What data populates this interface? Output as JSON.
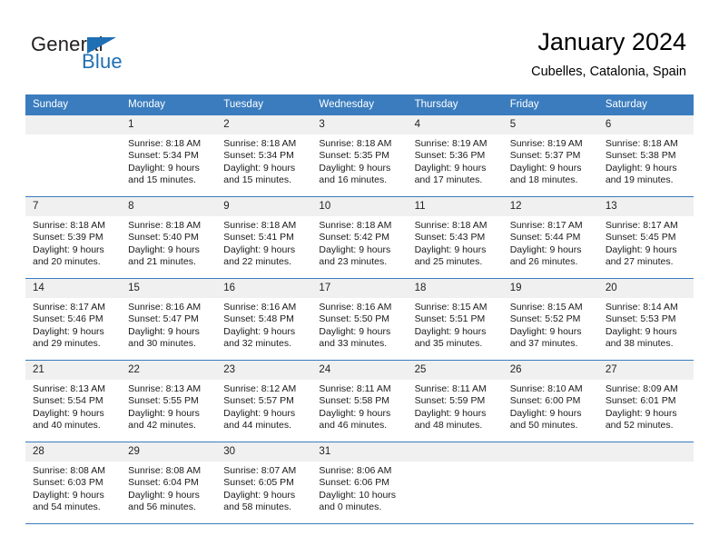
{
  "logo": {
    "word_one": "General",
    "word_two": "Blue",
    "flag_icon": "blue-triangle-flag",
    "accent_color": "#1f6fb4"
  },
  "header": {
    "title": "January 2024",
    "subtitle": "Cubelles, Catalonia, Spain"
  },
  "theme": {
    "header_row_bg": "#3a7cbe",
    "daynum_bg": "#f0f0f0",
    "cell_bg": "#ffffff",
    "text_color": "#000000"
  },
  "weekday_headers": [
    "Sunday",
    "Monday",
    "Tuesday",
    "Wednesday",
    "Thursday",
    "Friday",
    "Saturday"
  ],
  "weeks": [
    [
      {
        "day": "",
        "sunrise": "",
        "sunset": "",
        "daylight_line1": "",
        "daylight_line2": "",
        "empty": true
      },
      {
        "day": "1",
        "sunrise": "Sunrise: 8:18 AM",
        "sunset": "Sunset: 5:34 PM",
        "daylight_line1": "Daylight: 9 hours",
        "daylight_line2": "and 15 minutes.",
        "empty": false
      },
      {
        "day": "2",
        "sunrise": "Sunrise: 8:18 AM",
        "sunset": "Sunset: 5:34 PM",
        "daylight_line1": "Daylight: 9 hours",
        "daylight_line2": "and 15 minutes.",
        "empty": false
      },
      {
        "day": "3",
        "sunrise": "Sunrise: 8:18 AM",
        "sunset": "Sunset: 5:35 PM",
        "daylight_line1": "Daylight: 9 hours",
        "daylight_line2": "and 16 minutes.",
        "empty": false
      },
      {
        "day": "4",
        "sunrise": "Sunrise: 8:19 AM",
        "sunset": "Sunset: 5:36 PM",
        "daylight_line1": "Daylight: 9 hours",
        "daylight_line2": "and 17 minutes.",
        "empty": false
      },
      {
        "day": "5",
        "sunrise": "Sunrise: 8:19 AM",
        "sunset": "Sunset: 5:37 PM",
        "daylight_line1": "Daylight: 9 hours",
        "daylight_line2": "and 18 minutes.",
        "empty": false
      },
      {
        "day": "6",
        "sunrise": "Sunrise: 8:18 AM",
        "sunset": "Sunset: 5:38 PM",
        "daylight_line1": "Daylight: 9 hours",
        "daylight_line2": "and 19 minutes.",
        "empty": false
      }
    ],
    [
      {
        "day": "7",
        "sunrise": "Sunrise: 8:18 AM",
        "sunset": "Sunset: 5:39 PM",
        "daylight_line1": "Daylight: 9 hours",
        "daylight_line2": "and 20 minutes.",
        "empty": false
      },
      {
        "day": "8",
        "sunrise": "Sunrise: 8:18 AM",
        "sunset": "Sunset: 5:40 PM",
        "daylight_line1": "Daylight: 9 hours",
        "daylight_line2": "and 21 minutes.",
        "empty": false
      },
      {
        "day": "9",
        "sunrise": "Sunrise: 8:18 AM",
        "sunset": "Sunset: 5:41 PM",
        "daylight_line1": "Daylight: 9 hours",
        "daylight_line2": "and 22 minutes.",
        "empty": false
      },
      {
        "day": "10",
        "sunrise": "Sunrise: 8:18 AM",
        "sunset": "Sunset: 5:42 PM",
        "daylight_line1": "Daylight: 9 hours",
        "daylight_line2": "and 23 minutes.",
        "empty": false
      },
      {
        "day": "11",
        "sunrise": "Sunrise: 8:18 AM",
        "sunset": "Sunset: 5:43 PM",
        "daylight_line1": "Daylight: 9 hours",
        "daylight_line2": "and 25 minutes.",
        "empty": false
      },
      {
        "day": "12",
        "sunrise": "Sunrise: 8:17 AM",
        "sunset": "Sunset: 5:44 PM",
        "daylight_line1": "Daylight: 9 hours",
        "daylight_line2": "and 26 minutes.",
        "empty": false
      },
      {
        "day": "13",
        "sunrise": "Sunrise: 8:17 AM",
        "sunset": "Sunset: 5:45 PM",
        "daylight_line1": "Daylight: 9 hours",
        "daylight_line2": "and 27 minutes.",
        "empty": false
      }
    ],
    [
      {
        "day": "14",
        "sunrise": "Sunrise: 8:17 AM",
        "sunset": "Sunset: 5:46 PM",
        "daylight_line1": "Daylight: 9 hours",
        "daylight_line2": "and 29 minutes.",
        "empty": false
      },
      {
        "day": "15",
        "sunrise": "Sunrise: 8:16 AM",
        "sunset": "Sunset: 5:47 PM",
        "daylight_line1": "Daylight: 9 hours",
        "daylight_line2": "and 30 minutes.",
        "empty": false
      },
      {
        "day": "16",
        "sunrise": "Sunrise: 8:16 AM",
        "sunset": "Sunset: 5:48 PM",
        "daylight_line1": "Daylight: 9 hours",
        "daylight_line2": "and 32 minutes.",
        "empty": false
      },
      {
        "day": "17",
        "sunrise": "Sunrise: 8:16 AM",
        "sunset": "Sunset: 5:50 PM",
        "daylight_line1": "Daylight: 9 hours",
        "daylight_line2": "and 33 minutes.",
        "empty": false
      },
      {
        "day": "18",
        "sunrise": "Sunrise: 8:15 AM",
        "sunset": "Sunset: 5:51 PM",
        "daylight_line1": "Daylight: 9 hours",
        "daylight_line2": "and 35 minutes.",
        "empty": false
      },
      {
        "day": "19",
        "sunrise": "Sunrise: 8:15 AM",
        "sunset": "Sunset: 5:52 PM",
        "daylight_line1": "Daylight: 9 hours",
        "daylight_line2": "and 37 minutes.",
        "empty": false
      },
      {
        "day": "20",
        "sunrise": "Sunrise: 8:14 AM",
        "sunset": "Sunset: 5:53 PM",
        "daylight_line1": "Daylight: 9 hours",
        "daylight_line2": "and 38 minutes.",
        "empty": false
      }
    ],
    [
      {
        "day": "21",
        "sunrise": "Sunrise: 8:13 AM",
        "sunset": "Sunset: 5:54 PM",
        "daylight_line1": "Daylight: 9 hours",
        "daylight_line2": "and 40 minutes.",
        "empty": false
      },
      {
        "day": "22",
        "sunrise": "Sunrise: 8:13 AM",
        "sunset": "Sunset: 5:55 PM",
        "daylight_line1": "Daylight: 9 hours",
        "daylight_line2": "and 42 minutes.",
        "empty": false
      },
      {
        "day": "23",
        "sunrise": "Sunrise: 8:12 AM",
        "sunset": "Sunset: 5:57 PM",
        "daylight_line1": "Daylight: 9 hours",
        "daylight_line2": "and 44 minutes.",
        "empty": false
      },
      {
        "day": "24",
        "sunrise": "Sunrise: 8:11 AM",
        "sunset": "Sunset: 5:58 PM",
        "daylight_line1": "Daylight: 9 hours",
        "daylight_line2": "and 46 minutes.",
        "empty": false
      },
      {
        "day": "25",
        "sunrise": "Sunrise: 8:11 AM",
        "sunset": "Sunset: 5:59 PM",
        "daylight_line1": "Daylight: 9 hours",
        "daylight_line2": "and 48 minutes.",
        "empty": false
      },
      {
        "day": "26",
        "sunrise": "Sunrise: 8:10 AM",
        "sunset": "Sunset: 6:00 PM",
        "daylight_line1": "Daylight: 9 hours",
        "daylight_line2": "and 50 minutes.",
        "empty": false
      },
      {
        "day": "27",
        "sunrise": "Sunrise: 8:09 AM",
        "sunset": "Sunset: 6:01 PM",
        "daylight_line1": "Daylight: 9 hours",
        "daylight_line2": "and 52 minutes.",
        "empty": false
      }
    ],
    [
      {
        "day": "28",
        "sunrise": "Sunrise: 8:08 AM",
        "sunset": "Sunset: 6:03 PM",
        "daylight_line1": "Daylight: 9 hours",
        "daylight_line2": "and 54 minutes.",
        "empty": false
      },
      {
        "day": "29",
        "sunrise": "Sunrise: 8:08 AM",
        "sunset": "Sunset: 6:04 PM",
        "daylight_line1": "Daylight: 9 hours",
        "daylight_line2": "and 56 minutes.",
        "empty": false
      },
      {
        "day": "30",
        "sunrise": "Sunrise: 8:07 AM",
        "sunset": "Sunset: 6:05 PM",
        "daylight_line1": "Daylight: 9 hours",
        "daylight_line2": "and 58 minutes.",
        "empty": false
      },
      {
        "day": "31",
        "sunrise": "Sunrise: 8:06 AM",
        "sunset": "Sunset: 6:06 PM",
        "daylight_line1": "Daylight: 10 hours",
        "daylight_line2": "and 0 minutes.",
        "empty": false
      },
      {
        "day": "",
        "sunrise": "",
        "sunset": "",
        "daylight_line1": "",
        "daylight_line2": "",
        "empty": true
      },
      {
        "day": "",
        "sunrise": "",
        "sunset": "",
        "daylight_line1": "",
        "daylight_line2": "",
        "empty": true
      },
      {
        "day": "",
        "sunrise": "",
        "sunset": "",
        "daylight_line1": "",
        "daylight_line2": "",
        "empty": true
      }
    ]
  ]
}
